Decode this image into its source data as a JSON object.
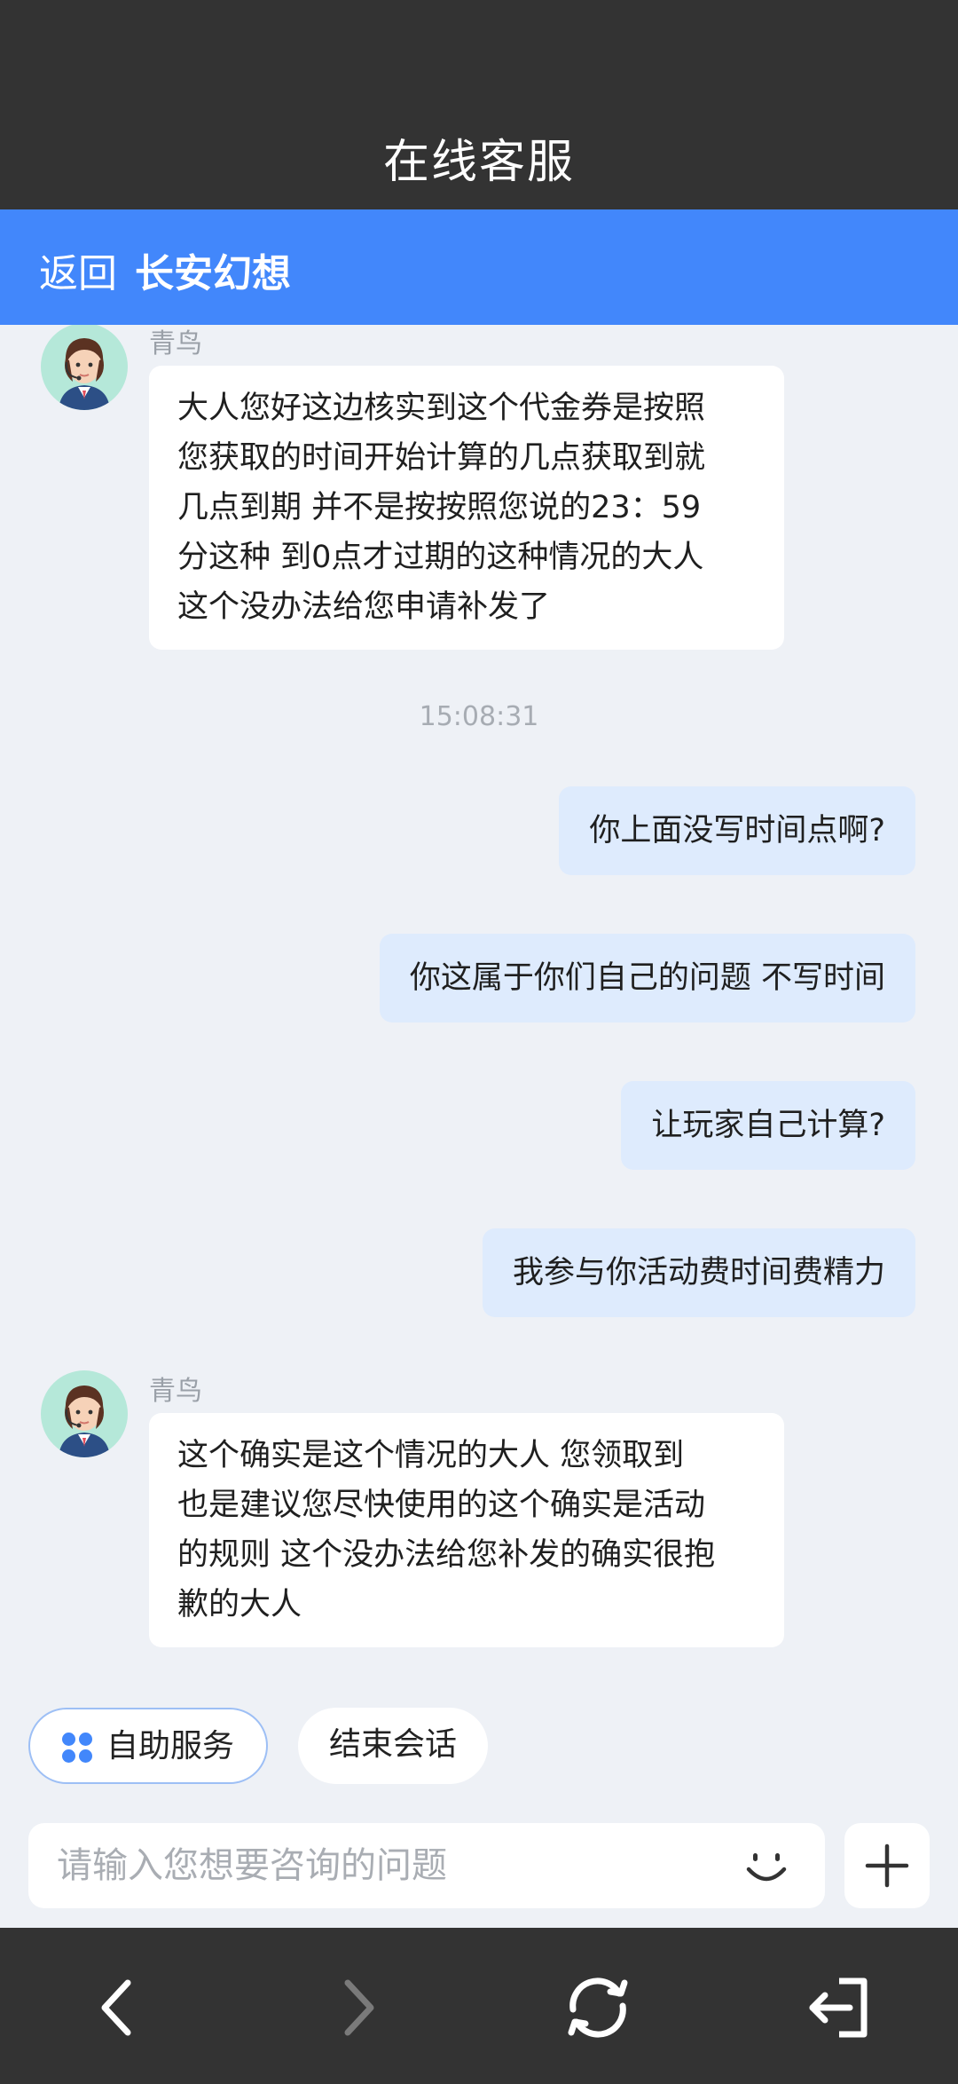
{
  "header": {
    "title": "在线客服"
  },
  "nav": {
    "back_label": "返回",
    "game_title": "长安幻想"
  },
  "messages": [
    {
      "from": "agent",
      "sender": "青鸟",
      "lines": [
        "大人您好这边核实到这个代金券是按照",
        "您获取的时间开始计算的几点获取到就",
        "几点到期 并不是按按照您说的23：59",
        "分这种 到0点才过期的这种情况的大人",
        "这个没办法给您申请补发了"
      ]
    },
    {
      "timestamp": "15:08:31"
    },
    {
      "from": "user",
      "text": "你上面没写时间点啊?"
    },
    {
      "from": "user",
      "text": "你这属于你们自己的问题 不写时间"
    },
    {
      "from": "user",
      "text": "让玩家自己计算?"
    },
    {
      "from": "user",
      "text": "我参与你活动费时间费精力"
    },
    {
      "from": "agent",
      "sender": "青鸟",
      "lines": [
        "这个确实是这个情况的大人  您领取到",
        "也是建议您尽快使用的这个确实是活动",
        "的规则 这个没办法给您补发的确实很抱",
        "歉的大人"
      ]
    }
  ],
  "quick_actions": {
    "self_service": "自助服务",
    "end_session": "结束会话"
  },
  "input": {
    "placeholder": "请输入您想要咨询的问题",
    "value": ""
  },
  "icons": {
    "avatar": "customer-service-agent-icon",
    "self_service": "four-dots-grid-icon",
    "emoji": "smiley-icon",
    "add": "plus-icon",
    "back": "chevron-left-icon",
    "forward": "chevron-right-icon",
    "refresh": "refresh-icon",
    "exit": "exit-icon"
  },
  "colors": {
    "header_bg": "#333333",
    "nav_bg": "#4287fb",
    "user_bubble": "#deebfd",
    "agent_bubble": "#ffffff",
    "chat_bg": "#eef1f6"
  }
}
